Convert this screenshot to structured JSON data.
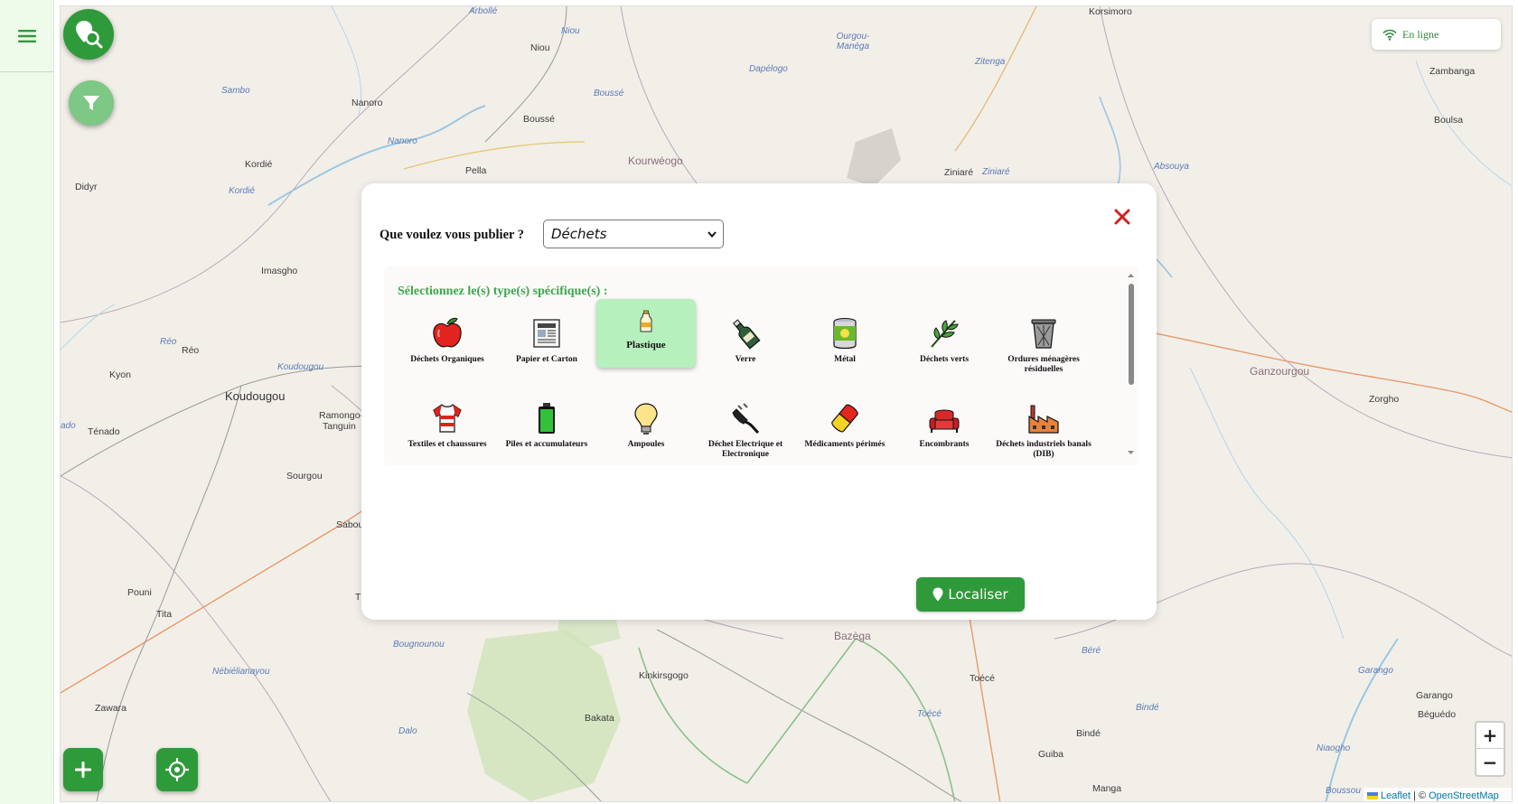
{
  "status": {
    "label": "En ligne"
  },
  "modal": {
    "question": "Que voulez vous publier ?",
    "category_selected": "Déchets",
    "types_heading": "Sélectionnez le(s) type(s) spécifique(s) :",
    "types": [
      {
        "label": "Déchets Organiques",
        "icon": "apple-icon",
        "selected": false
      },
      {
        "label": "Papier et Carton",
        "icon": "newspaper-icon",
        "selected": false
      },
      {
        "label": "Plastique",
        "icon": "plastic-bottle-icon",
        "selected": true
      },
      {
        "label": "Verre",
        "icon": "glass-bottle-icon",
        "selected": false
      },
      {
        "label": "Métal",
        "icon": "can-icon",
        "selected": false
      },
      {
        "label": "Déchets verts",
        "icon": "leaf-icon",
        "selected": false
      },
      {
        "label": "Ordures ménagères résiduelles",
        "icon": "trash-bin-icon",
        "selected": false
      },
      {
        "label": "Textiles et chaussures",
        "icon": "shirt-icon",
        "selected": false
      },
      {
        "label": "Piles et accumulateurs",
        "icon": "battery-icon",
        "selected": false
      },
      {
        "label": "Ampoules",
        "icon": "light-bulb-icon",
        "selected": false
      },
      {
        "label": "Déchet Electrique et Electronique",
        "icon": "plug-icon",
        "selected": false
      },
      {
        "label": "Médicaments périmés",
        "icon": "pill-icon",
        "selected": false
      },
      {
        "label": "Encombrants",
        "icon": "sofa-icon",
        "selected": false
      },
      {
        "label": "Déchets industriels banals (DIB)",
        "icon": "factory-icon",
        "selected": false
      }
    ],
    "localiser_label": "Localiser"
  },
  "map": {
    "zoom_in": "+",
    "zoom_out": "−",
    "attribution_leaflet": "Leaflet",
    "attribution_sep": "| ©",
    "attribution_osm": "OpenStreetMap",
    "places": [
      {
        "name": "Korsimoro",
        "cls": ""
      },
      {
        "name": "Arbollé",
        "cls": "water"
      },
      {
        "name": "Niou",
        "cls": ""
      },
      {
        "name": "Niou",
        "cls": "water"
      },
      {
        "name": "Ourgou-Manéga",
        "cls": "water"
      },
      {
        "name": "Zambanga",
        "cls": ""
      },
      {
        "name": "Sambo",
        "cls": "water"
      },
      {
        "name": "Nanoro",
        "cls": ""
      },
      {
        "name": "Dapélogo",
        "cls": "water"
      },
      {
        "name": "Zitenga",
        "cls": "water"
      },
      {
        "name": "Boulsa",
        "cls": ""
      },
      {
        "name": "Boussé",
        "cls": "water"
      },
      {
        "name": "Boussé",
        "cls": ""
      },
      {
        "name": "Nanoro",
        "cls": "water"
      },
      {
        "name": "Kordié",
        "cls": ""
      },
      {
        "name": "Pella",
        "cls": ""
      },
      {
        "name": "Kourwéogo",
        "cls": "district"
      },
      {
        "name": "Ziniaré",
        "cls": ""
      },
      {
        "name": "Ziniaré",
        "cls": "water"
      },
      {
        "name": "Absouya",
        "cls": "water"
      },
      {
        "name": "Didyr",
        "cls": ""
      },
      {
        "name": "Kordié",
        "cls": "water"
      },
      {
        "name": "Imasgho",
        "cls": ""
      },
      {
        "name": "Réo",
        "cls": "water"
      },
      {
        "name": "Réo",
        "cls": ""
      },
      {
        "name": "Kyon",
        "cls": ""
      },
      {
        "name": "Koudougou",
        "cls": "water"
      },
      {
        "name": "Koudougou",
        "cls": "big"
      },
      {
        "name": "Ramongo-",
        "cls": ""
      },
      {
        "name": "Tanguin",
        "cls": ""
      },
      {
        "name": "Ténado",
        "cls": ""
      },
      {
        "name": "ado",
        "cls": "water"
      },
      {
        "name": "Sourgou",
        "cls": ""
      },
      {
        "name": "Sabou",
        "cls": ""
      },
      {
        "name": "Ganzourgou",
        "cls": "district"
      },
      {
        "name": "Zorgho",
        "cls": ""
      },
      {
        "name": "Pouni",
        "cls": ""
      },
      {
        "name": "Tita",
        "cls": ""
      },
      {
        "name": "Th",
        "cls": ""
      },
      {
        "name": "Bazèga",
        "cls": "district"
      },
      {
        "name": "Bougnounou",
        "cls": "water"
      },
      {
        "name": "Nébiélianayou",
        "cls": "water"
      },
      {
        "name": "Kinkirsgogo",
        "cls": ""
      },
      {
        "name": "Toécé",
        "cls": ""
      },
      {
        "name": "Béré",
        "cls": "water"
      },
      {
        "name": "Garango",
        "cls": "water"
      },
      {
        "name": "Garango",
        "cls": ""
      },
      {
        "name": "Zawara",
        "cls": ""
      },
      {
        "name": "Bakata",
        "cls": ""
      },
      {
        "name": "Toécé",
        "cls": "water"
      },
      {
        "name": "Béguédo",
        "cls": ""
      },
      {
        "name": "Dalo",
        "cls": "water"
      },
      {
        "name": "Bindé",
        "cls": "water"
      },
      {
        "name": "Bindé",
        "cls": ""
      },
      {
        "name": "Guiba",
        "cls": ""
      },
      {
        "name": "Niaogho",
        "cls": "water"
      },
      {
        "name": "Manga",
        "cls": ""
      },
      {
        "name": "Boussou",
        "cls": "water"
      }
    ]
  },
  "colors": {
    "accent": "#2e9a3a",
    "close": "#d42020",
    "selected_bg": "#b5f0bd",
    "heading": "#3aa64a"
  }
}
